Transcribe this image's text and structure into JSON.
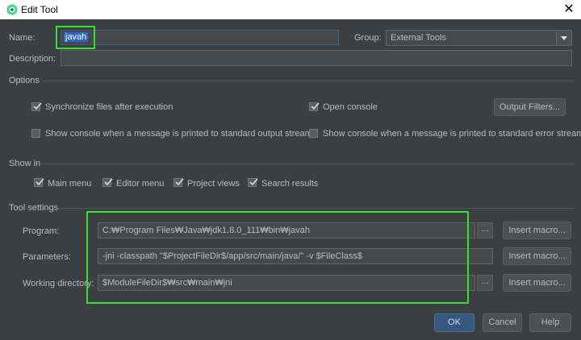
{
  "window": {
    "title": "Edit Tool",
    "close_glyph": "✕"
  },
  "name": {
    "label": "Name:",
    "value": "javah"
  },
  "group": {
    "label": "Group:",
    "value": "External Tools"
  },
  "description": {
    "label": "Description:",
    "value": ""
  },
  "options": {
    "header": "Options",
    "sync_files": {
      "label": "Synchronize files after execution",
      "checked": true
    },
    "open_console": {
      "label": "Open console",
      "checked": true
    },
    "output_filters_button": "Output Filters...",
    "show_stdout": {
      "label": "Show console when a message is printed to standard output stream",
      "checked": false
    },
    "show_stderr": {
      "label": "Show console when a message is printed to standard error stream",
      "checked": false
    }
  },
  "show_in": {
    "header": "Show in",
    "main_menu": {
      "label": "Main menu",
      "checked": true
    },
    "editor_menu": {
      "label": "Editor menu",
      "checked": true
    },
    "project_views": {
      "label": "Project views",
      "checked": true
    },
    "search_results": {
      "label": "Search results",
      "checked": true
    }
  },
  "tool_settings": {
    "header": "Tool settings",
    "program": {
      "label": "Program:",
      "value": "C:₩Program Files₩Java₩jdk1.8.0_111₩bin₩javah"
    },
    "parameters": {
      "label": "Parameters:",
      "value": "-jni -classpath \"$ProjectFileDir$/app/src/main/java/\" -v $FileClass$"
    },
    "working_directory": {
      "label": "Working directory:",
      "value": "$ModuleFileDir$₩src₩main₩jni"
    },
    "browse_glyph": "...",
    "insert_macro_label": "Insert macro..."
  },
  "footer": {
    "ok": "OK",
    "cancel": "Cancel",
    "help": "Help"
  },
  "colors": {
    "background": "#3c3f41",
    "highlight": "#33e32c",
    "primary_button": "#365880",
    "selection": "#2f65ca"
  }
}
